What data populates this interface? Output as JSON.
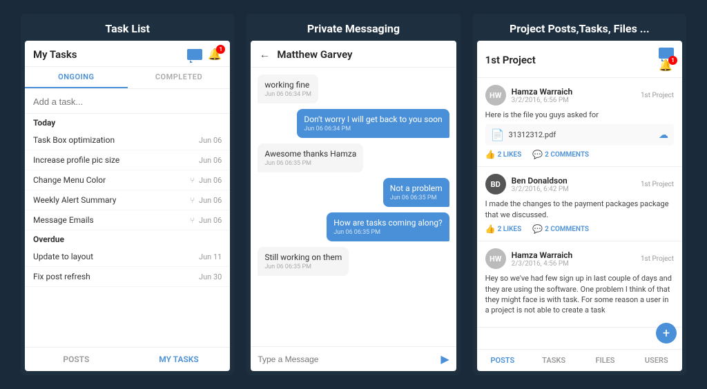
{
  "panels": [
    {
      "header": "Task List",
      "phone": {
        "top": {
          "title": "My Tasks",
          "chat_icon": true,
          "bell_badge": "1"
        },
        "tabs": [
          {
            "label": "ONGOING",
            "active": true
          },
          {
            "label": "COMPLETED",
            "active": false
          }
        ],
        "add_placeholder": "Add a task...",
        "sections": [
          {
            "label": "Today",
            "tasks": [
              {
                "name": "Task Box optimization",
                "date": "Jun 06",
                "branch": false
              },
              {
                "name": "Increase profile pic size",
                "date": "Jun 06",
                "branch": false
              },
              {
                "name": "Change Menu Color",
                "date": "Jun 06",
                "branch": true
              },
              {
                "name": "Weekly Alert Summary",
                "date": "Jun 06",
                "branch": true
              },
              {
                "name": "Message Emails",
                "date": "Jun 06",
                "branch": true
              }
            ]
          },
          {
            "label": "Overdue",
            "tasks": [
              {
                "name": "Update to layout",
                "date": "Jun 11",
                "branch": false
              },
              {
                "name": "Fix post refresh",
                "date": "Jun 30",
                "branch": false
              }
            ]
          }
        ],
        "bottom_nav": [
          {
            "label": "POSTS",
            "active": false
          },
          {
            "label": "MY TASKS",
            "active": true
          }
        ]
      }
    },
    {
      "header": "Private Messaging",
      "phone": {
        "top": {
          "contact": "Matthew Garvey"
        },
        "messages": [
          {
            "side": "left",
            "text": "working fine",
            "time": "Jun 06 06:34 PM"
          },
          {
            "side": "right",
            "text": "Don't worry I will get back to you soon",
            "time": "Jun 06 06:34 PM"
          },
          {
            "side": "left",
            "text": "Awesome thanks Hamza",
            "time": "Jun 06 06:35 PM"
          },
          {
            "side": "right",
            "text": "Not a problem",
            "time": "Jun 06 06:35 PM"
          },
          {
            "side": "right",
            "text": "How are tasks coming along?",
            "time": "Jun 06 06:35 PM"
          },
          {
            "side": "left",
            "text": "Still working on them",
            "time": "Jun 06 06:35 PM"
          }
        ],
        "input_placeholder": "Type a Message"
      }
    },
    {
      "header": "Project Posts,Tasks, Files ...",
      "phone": {
        "top": {
          "title": "1st Project",
          "bell_badge": "1"
        },
        "posts": [
          {
            "avatar_initials": "HW",
            "avatar_dark": false,
            "author": "Hamza Warraich",
            "date": "3/2/2016, 6:56 PM",
            "project_tag": "1st Project",
            "body": "Here is the file you guys asked for",
            "file": "31312312.pdf",
            "likes": "2 LIKES",
            "comments": "2 COMMENTS"
          },
          {
            "avatar_initials": "BD",
            "avatar_dark": true,
            "author": "Ben Donaldson",
            "date": "3/2/2016, 6:42 PM",
            "project_tag": "1st Project",
            "body": "I made the changes to the payment packages package that we discussed.",
            "file": null,
            "likes": "2 LIKES",
            "comments": "2 COMMENTS"
          },
          {
            "avatar_initials": "HW",
            "avatar_dark": false,
            "author": "Hamza Warraich",
            "date": "2/3/2016, 4:56 PM",
            "project_tag": "1st Project",
            "body": "Hey so we've had few sign up in last couple of days and they are using the software. One problem I think of that they might face is with task. For some reason a user in a project is not able to create a task",
            "file": null,
            "likes": null,
            "comments": null
          }
        ],
        "fab_label": "+",
        "bottom_nav": [
          {
            "label": "POSTS",
            "active": true
          },
          {
            "label": "TASKS",
            "active": false
          },
          {
            "label": "FILES",
            "active": false
          },
          {
            "label": "USERS",
            "active": false
          }
        ]
      }
    }
  ]
}
